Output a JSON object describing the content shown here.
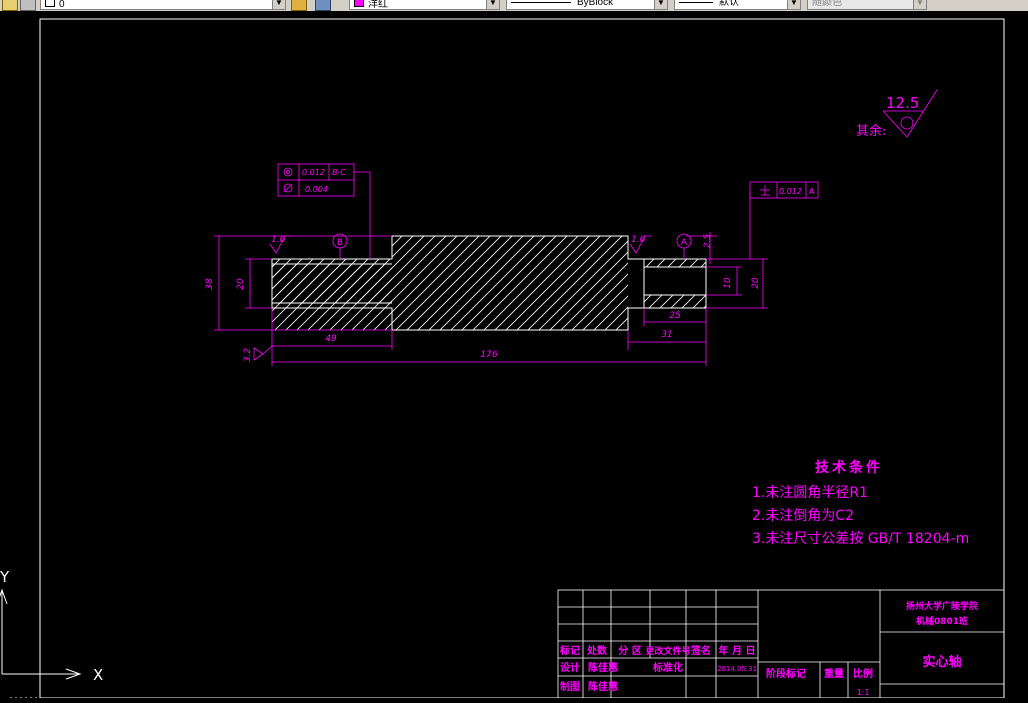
{
  "toolbar": {
    "layer_value": "0",
    "color_value": "洋红",
    "linetype_value": "ByBlock",
    "lineweight_value": "默认",
    "plotstyle_value": "随颜色"
  },
  "drawing": {
    "roughness_value": "12.5",
    "roughness_label": "其余:",
    "tol_left_row1_value": "0.012",
    "tol_left_row1_datum": "B-C",
    "tol_left_row2_value": "0.004",
    "tol_right_value": "0.012",
    "tol_right_datum": "A",
    "datum_b": "B",
    "datum_a": "A",
    "rough_left": "1.6",
    "rough_right": "1.6",
    "rough_bottom": "3.2",
    "dim_38": "38",
    "dim_20_left": "20",
    "dim_49": "49",
    "dim_176": "176",
    "dim_31": "31",
    "dim_25": "25",
    "dim_10": "10",
    "dim_20_right": "20",
    "dim_2_5": "2.5"
  },
  "tech": {
    "title": "技术条件",
    "item1": "1.未注圆角半径R1",
    "item2": "2.未注倒角为C2",
    "item3": "3.未注尺寸公差按 GB/T 18204-m"
  },
  "titleblock": {
    "school": "扬州大学广陵学院",
    "class": "机械0801班",
    "part_name": "实心轴",
    "h_mark": "标记",
    "h_count": "处数",
    "h_zone": "分 区",
    "h_docno": "更改文件号",
    "h_sign": "签名",
    "h_date": "年 月 日",
    "h_design": "设计",
    "design_name": "陈佳惠",
    "h_std": "标准化",
    "design_date": "2014.05.31",
    "h_stage": "阶段标记",
    "h_weight": "重量",
    "h_scale": "比例",
    "h_draw": "制图",
    "draw_name": "陈佳惠",
    "scale_value": "1:1"
  },
  "ucs": {
    "y_label": "Y",
    "x_label": "X"
  }
}
